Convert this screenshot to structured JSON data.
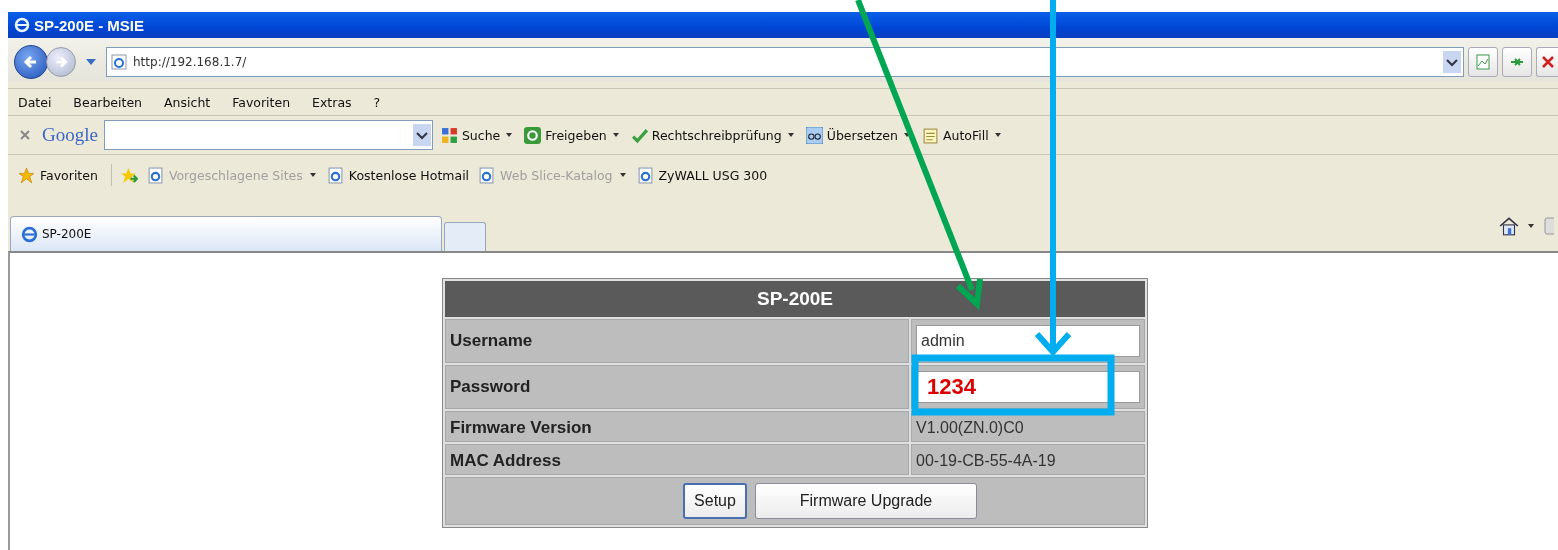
{
  "window": {
    "title": "SP-200E - MSIE"
  },
  "address_bar": {
    "url": "http://192.168.1.7/"
  },
  "menu": [
    "Datei",
    "Bearbeiten",
    "Ansicht",
    "Favoriten",
    "Extras",
    "?"
  ],
  "google_toolbar": {
    "logo": "Google",
    "items": [
      {
        "label": "Suche",
        "kind": "search",
        "dropdown": true
      },
      {
        "label": "Freigeben",
        "kind": "share",
        "dropdown": true
      },
      {
        "label": "Rechtschreibprüfung",
        "kind": "spell",
        "dropdown": true
      },
      {
        "label": "Übersetzen",
        "kind": "translate",
        "dropdown": true
      },
      {
        "label": "AutoFill",
        "kind": "autofill",
        "dropdown": true
      }
    ]
  },
  "favorites_bar": {
    "label": "Favoriten",
    "links": [
      {
        "label": "Vorgeschlagene Sites",
        "disabled": true,
        "dropdown": true
      },
      {
        "label": "Kostenlose Hotmail",
        "disabled": false,
        "dropdown": false
      },
      {
        "label": "Web Slice-Katalog",
        "disabled": true,
        "dropdown": true
      },
      {
        "label": "ZyWALL USG 300",
        "disabled": false,
        "dropdown": false
      }
    ]
  },
  "tabs": [
    {
      "label": "SP-200E",
      "selected": true
    }
  ],
  "form": {
    "title": "SP-200E",
    "rows": [
      {
        "label": "Username",
        "kind": "input",
        "value": "admin",
        "highlighted": false
      },
      {
        "label": "Password",
        "kind": "input",
        "value": "1234",
        "highlighted": true
      },
      {
        "label": "Firmware Version",
        "kind": "text",
        "value": "V1.00(ZN.0)C0"
      },
      {
        "label": "MAC Address",
        "kind": "text",
        "value": "00-19-CB-55-4A-19"
      }
    ],
    "buttons": [
      "Setup",
      "Firmware Upgrade"
    ]
  },
  "annotations": [
    {
      "kind": "arrow",
      "color": "#00a651"
    },
    {
      "kind": "arrow-box",
      "color": "#00aeef"
    }
  ]
}
